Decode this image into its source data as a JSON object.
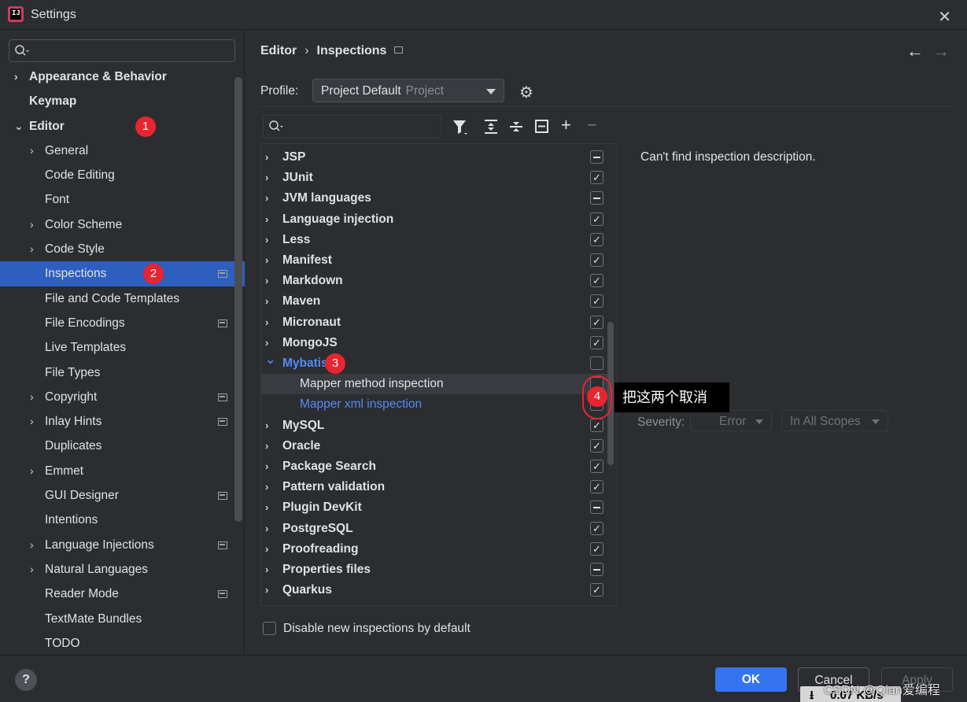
{
  "window": {
    "title": "Settings",
    "icon": "intellij-app-icon",
    "close_glyph": "✕"
  },
  "sidebar": {
    "search_placeholder": "",
    "items": [
      {
        "label": "Appearance & Behavior",
        "level": 0,
        "chevron": "›",
        "bold": true
      },
      {
        "label": "Keymap",
        "level": 0,
        "chevron": "",
        "bold": true
      },
      {
        "label": "Editor",
        "level": 0,
        "chevron": "⌄",
        "bold": true,
        "badge": "1"
      },
      {
        "label": "General",
        "level": 1,
        "chevron": "›"
      },
      {
        "label": "Code Editing",
        "level": 1,
        "chevron": ""
      },
      {
        "label": "Font",
        "level": 1,
        "chevron": ""
      },
      {
        "label": "Color Scheme",
        "level": 1,
        "chevron": "›"
      },
      {
        "label": "Code Style",
        "level": 1,
        "chevron": "›"
      },
      {
        "label": "Inspections",
        "level": 1,
        "chevron": "",
        "selected": true,
        "project_icon": true,
        "badge": "2"
      },
      {
        "label": "File and Code Templates",
        "level": 1,
        "chevron": ""
      },
      {
        "label": "File Encodings",
        "level": 1,
        "chevron": "",
        "project_icon": true
      },
      {
        "label": "Live Templates",
        "level": 1,
        "chevron": ""
      },
      {
        "label": "File Types",
        "level": 1,
        "chevron": ""
      },
      {
        "label": "Copyright",
        "level": 1,
        "chevron": "›",
        "project_icon": true
      },
      {
        "label": "Inlay Hints",
        "level": 1,
        "chevron": "›",
        "project_icon": true
      },
      {
        "label": "Duplicates",
        "level": 1,
        "chevron": ""
      },
      {
        "label": "Emmet",
        "level": 1,
        "chevron": "›"
      },
      {
        "label": "GUI Designer",
        "level": 1,
        "chevron": "",
        "project_icon": true
      },
      {
        "label": "Intentions",
        "level": 1,
        "chevron": ""
      },
      {
        "label": "Language Injections",
        "level": 1,
        "chevron": "›",
        "project_icon": true
      },
      {
        "label": "Natural Languages",
        "level": 1,
        "chevron": "›"
      },
      {
        "label": "Reader Mode",
        "level": 1,
        "chevron": "",
        "project_icon": true
      },
      {
        "label": "TextMate Bundles",
        "level": 1,
        "chevron": ""
      },
      {
        "label": "TODO",
        "level": 1,
        "chevron": ""
      }
    ]
  },
  "breadcrumb": {
    "parent": "Editor",
    "separator": "›",
    "current": "Inspections"
  },
  "nav": {
    "back": "←",
    "forward": "→"
  },
  "profile": {
    "label": "Profile:",
    "value": "Project Default",
    "scope": "Project"
  },
  "toolbar": {
    "filter": "filter-icon",
    "expand_all": "expand-all-icon",
    "collapse_all": "collapse-all-icon",
    "reset": "reset-icon",
    "add": "+",
    "remove": "−"
  },
  "inspections": [
    {
      "label": "JSP",
      "state": "partial"
    },
    {
      "label": "JUnit",
      "state": "checked"
    },
    {
      "label": "JVM languages",
      "state": "partial"
    },
    {
      "label": "Language injection",
      "state": "checked"
    },
    {
      "label": "Less",
      "state": "checked"
    },
    {
      "label": "Manifest",
      "state": "checked"
    },
    {
      "label": "Markdown",
      "state": "checked"
    },
    {
      "label": "Maven",
      "state": "checked"
    },
    {
      "label": "Micronaut",
      "state": "checked"
    },
    {
      "label": "MongoJS",
      "state": "checked"
    },
    {
      "label": "Mybatis",
      "state": "unchecked",
      "expanded": true,
      "blue": true,
      "badge": "3"
    },
    {
      "label": "Mapper method inspection",
      "state": "unchecked",
      "child": true,
      "highlight": true
    },
    {
      "label": "Mapper xml inspection",
      "state": "unchecked",
      "child": true,
      "blue": true
    },
    {
      "label": "MySQL",
      "state": "checked"
    },
    {
      "label": "Oracle",
      "state": "checked"
    },
    {
      "label": "Package Search",
      "state": "checked"
    },
    {
      "label": "Pattern validation",
      "state": "checked"
    },
    {
      "label": "Plugin DevKit",
      "state": "partial"
    },
    {
      "label": "PostgreSQL",
      "state": "checked"
    },
    {
      "label": "Proofreading",
      "state": "checked"
    },
    {
      "label": "Properties files",
      "state": "partial"
    },
    {
      "label": "Quarkus",
      "state": "checked"
    }
  ],
  "description": "Can't find inspection description.",
  "severity": {
    "label": "Severity:",
    "value": "Error",
    "scope": "In All Scopes"
  },
  "annotation": {
    "badge": "4",
    "text": "把这两个取消"
  },
  "disable_new": {
    "label": "Disable new inspections by default",
    "checked": false
  },
  "footer": {
    "help": "?",
    "ok": "OK",
    "cancel": "Cancel",
    "apply": "Apply"
  },
  "overlay": {
    "watermark": "CSDN @Qian爱编程",
    "net_speed": "0.07 KB/s",
    "download_glyph": "⭳"
  },
  "colors": {
    "accent": "#3574f0",
    "selected": "#2e5fbf",
    "link": "#548af7",
    "badge": "#e8242f"
  }
}
